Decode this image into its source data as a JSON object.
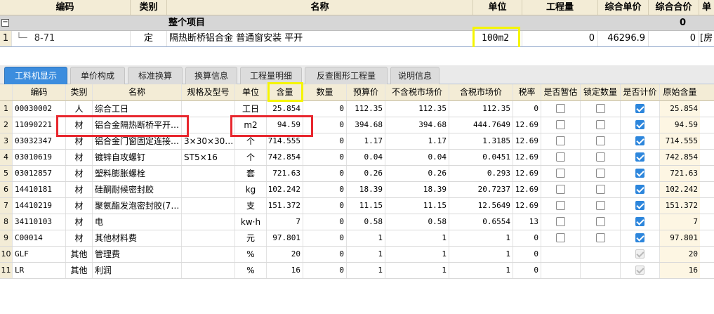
{
  "top_table": {
    "headers": [
      "编码",
      "类别",
      "名称",
      "单位",
      "工程量",
      "综合单价",
      "综合合价",
      "单"
    ],
    "group_row": {
      "label": "整个项目",
      "total": "0",
      "expand_symbol": "−"
    },
    "item_row": {
      "row_no": "1",
      "code": "8-71",
      "category": "定",
      "name": "隔热断桥铝合金 普通窗安装 平开",
      "unit": "100m2",
      "quantity": "0",
      "unit_price": "46296.9",
      "total_price": "0",
      "extra": "[房"
    }
  },
  "tabs": [
    {
      "label": "工料机显示",
      "active": true
    },
    {
      "label": "单价构成",
      "active": false
    },
    {
      "label": "标准换算",
      "active": false
    },
    {
      "label": "换算信息",
      "active": false
    },
    {
      "label": "工程量明细",
      "active": false
    },
    {
      "label": "反查图形工程量",
      "active": false
    },
    {
      "label": "说明信息",
      "active": false
    }
  ],
  "grid": {
    "headers": [
      "编码",
      "类别",
      "名称",
      "规格及型号",
      "单位",
      "含量",
      "数量",
      "预算价",
      "不含税市场价",
      "含税市场价",
      "税率",
      "是否暂估",
      "锁定数量",
      "是否计价",
      "原始含量"
    ],
    "rows": [
      {
        "no": "1",
        "code": "00030002",
        "cat": "人",
        "name": "综合工日",
        "spec": "",
        "unit": "工日",
        "content": "25.854",
        "qty": "0",
        "budget": "112.35",
        "mkt_ex": "112.35",
        "mkt_in": "112.35",
        "tax": "0",
        "est": false,
        "lock": false,
        "priced": true,
        "priced_dim": false,
        "orig": "25.854"
      },
      {
        "no": "2",
        "code": "11090221",
        "cat": "材",
        "name": "铝合金隔热断桥平开…",
        "spec": "",
        "unit": "m2",
        "content": "94.59",
        "qty": "0",
        "budget": "394.68",
        "mkt_ex": "394.68",
        "mkt_in": "444.7649",
        "tax": "12.69",
        "est": false,
        "lock": false,
        "priced": true,
        "priced_dim": false,
        "orig": "94.59"
      },
      {
        "no": "3",
        "code": "03032347",
        "cat": "材",
        "name": "铝合金门窗固定连接…",
        "spec": "3×30×30…",
        "unit": "个",
        "content": "714.555",
        "qty": "0",
        "budget": "1.17",
        "mkt_ex": "1.17",
        "mkt_in": "1.3185",
        "tax": "12.69",
        "est": false,
        "lock": false,
        "priced": true,
        "priced_dim": false,
        "orig": "714.555"
      },
      {
        "no": "4",
        "code": "03010619",
        "cat": "材",
        "name": "镀锌自攻螺钉",
        "spec": "ST5×16",
        "unit": "个",
        "content": "742.854",
        "qty": "0",
        "budget": "0.04",
        "mkt_ex": "0.04",
        "mkt_in": "0.0451",
        "tax": "12.69",
        "est": false,
        "lock": false,
        "priced": true,
        "priced_dim": false,
        "orig": "742.854"
      },
      {
        "no": "5",
        "code": "03012857",
        "cat": "材",
        "name": "塑料膨胀螺栓",
        "spec": "",
        "unit": "套",
        "content": "721.63",
        "qty": "0",
        "budget": "0.26",
        "mkt_ex": "0.26",
        "mkt_in": "0.293",
        "tax": "12.69",
        "est": false,
        "lock": false,
        "priced": true,
        "priced_dim": false,
        "orig": "721.63"
      },
      {
        "no": "6",
        "code": "14410181",
        "cat": "材",
        "name": "硅酮耐候密封胶",
        "spec": "",
        "unit": "kg",
        "content": "102.242",
        "qty": "0",
        "budget": "18.39",
        "mkt_ex": "18.39",
        "mkt_in": "20.7237",
        "tax": "12.69",
        "est": false,
        "lock": false,
        "priced": true,
        "priced_dim": false,
        "orig": "102.242"
      },
      {
        "no": "7",
        "code": "14410219",
        "cat": "材",
        "name": "聚氨酯发泡密封胶(7…",
        "spec": "",
        "unit": "支",
        "content": "151.372",
        "qty": "0",
        "budget": "11.15",
        "mkt_ex": "11.15",
        "mkt_in": "12.5649",
        "tax": "12.69",
        "est": false,
        "lock": false,
        "priced": true,
        "priced_dim": false,
        "orig": "151.372"
      },
      {
        "no": "8",
        "code": "34110103",
        "cat": "材",
        "name": "电",
        "spec": "",
        "unit": "kw·h",
        "content": "7",
        "qty": "0",
        "budget": "0.58",
        "mkt_ex": "0.58",
        "mkt_in": "0.6554",
        "tax": "13",
        "est": false,
        "lock": false,
        "priced": true,
        "priced_dim": false,
        "orig": "7"
      },
      {
        "no": "9",
        "code": "C00014",
        "cat": "材",
        "name": "其他材料费",
        "spec": "",
        "unit": "元",
        "content": "97.801",
        "qty": "0",
        "budget": "1",
        "mkt_ex": "1",
        "mkt_in": "1",
        "tax": "0",
        "est": false,
        "lock": false,
        "priced": true,
        "priced_dim": false,
        "orig": "97.801"
      },
      {
        "no": "10",
        "code": "GLF",
        "cat": "其他",
        "name": "管理费",
        "spec": "",
        "unit": "%",
        "content": "20",
        "qty": "0",
        "budget": "1",
        "mkt_ex": "1",
        "mkt_in": "1",
        "tax": "0",
        "est": null,
        "lock": null,
        "priced": true,
        "priced_dim": true,
        "orig": "20"
      },
      {
        "no": "11",
        "code": "LR",
        "cat": "其他",
        "name": "利润",
        "spec": "",
        "unit": "%",
        "content": "16",
        "qty": "0",
        "budget": "1",
        "mkt_ex": "1",
        "mkt_in": "1",
        "tax": "0",
        "est": null,
        "lock": null,
        "priced": true,
        "priced_dim": true,
        "orig": "16"
      }
    ]
  },
  "colors": {
    "highlight_yellow": "#f5f500",
    "highlight_red": "#e8272e",
    "tab_active": "#3c8dde",
    "header_bg": "#f3ecd6",
    "checkbox_checked": "#2d86dc"
  }
}
